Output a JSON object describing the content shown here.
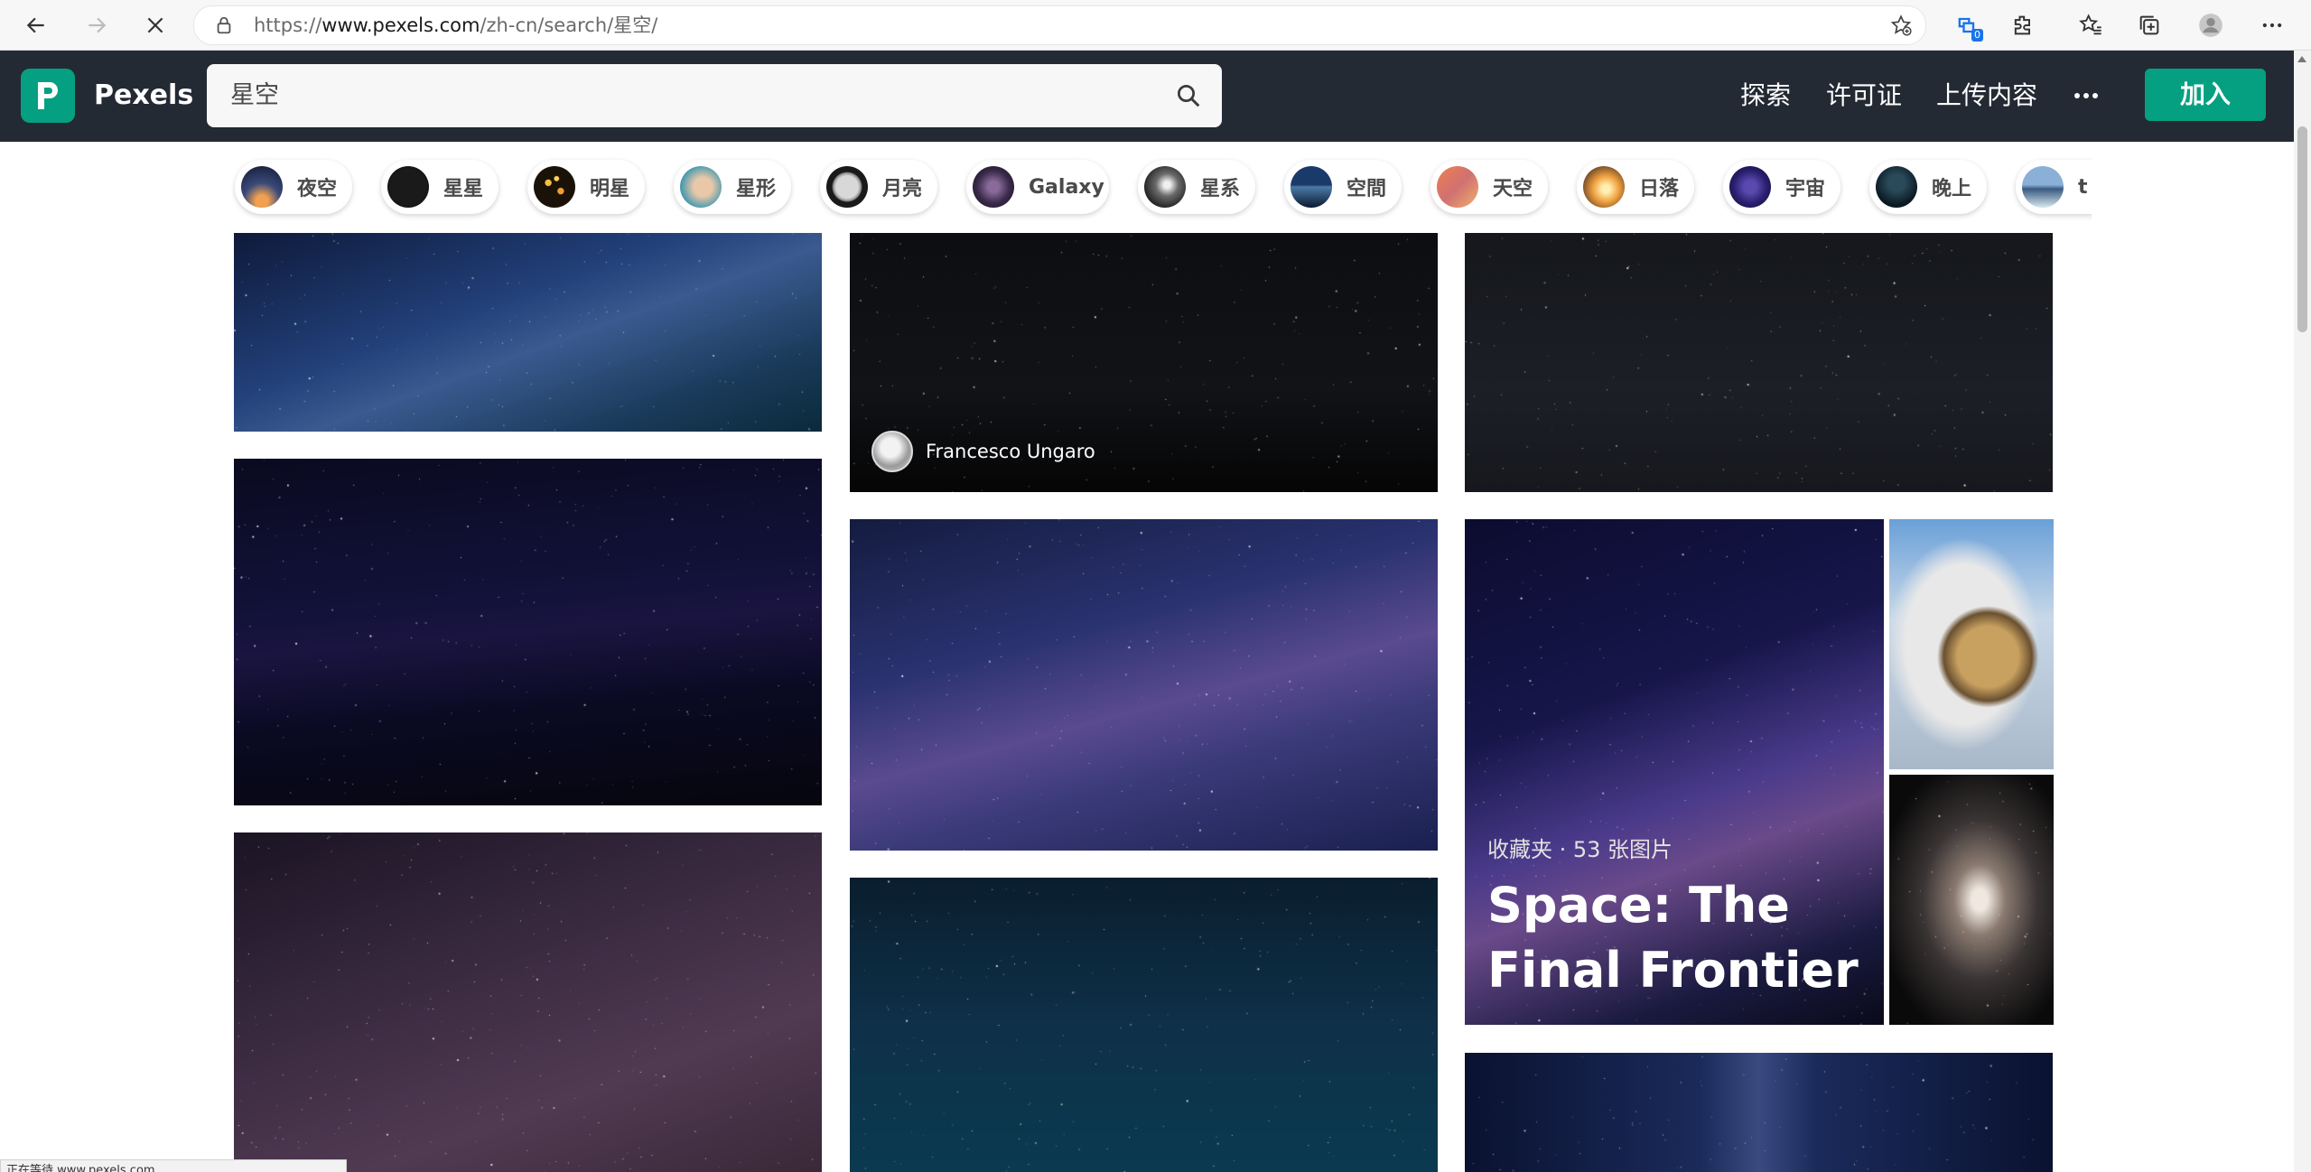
{
  "browser": {
    "url_prefix": "https://",
    "url_host": "www.pexels.com",
    "url_path": "/zh-cn/search/星空/",
    "extensions_badge": "0"
  },
  "header": {
    "brand": "Pexels",
    "search_value": "星空",
    "nav": [
      "探索",
      "许可证",
      "上传内容"
    ],
    "join_label": "加入"
  },
  "chips": [
    {
      "label": "夜空"
    },
    {
      "label": "星星"
    },
    {
      "label": "明星"
    },
    {
      "label": "星形"
    },
    {
      "label": "月亮"
    },
    {
      "label": "Galaxy"
    },
    {
      "label": "星系"
    },
    {
      "label": "空間"
    },
    {
      "label": "天空"
    },
    {
      "label": "日落"
    },
    {
      "label": "宇宙"
    },
    {
      "label": "晚上"
    },
    {
      "label": "t"
    }
  ],
  "photos": {
    "featured_author": "Francesco Ungaro"
  },
  "collection": {
    "meta": "收藏夹 · 53 张图片",
    "title": "Space: The Final Frontier"
  },
  "status_bar": "正在等待 www.pexels.com..."
}
